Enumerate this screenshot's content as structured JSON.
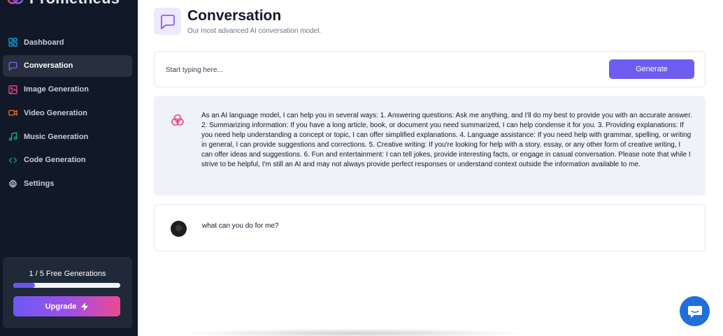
{
  "brand": {
    "name": "Prometheus"
  },
  "sidebar": {
    "items": [
      {
        "label": "Dashboard",
        "icon": "dashboard-icon",
        "color": "#0ea5e9"
      },
      {
        "label": "Conversation",
        "icon": "message-square-icon",
        "color": "#8b5cf6",
        "active": true
      },
      {
        "label": "Image Generation",
        "icon": "image-icon",
        "color": "#ec4899"
      },
      {
        "label": "Video Generation",
        "icon": "video-icon",
        "color": "#f97316"
      },
      {
        "label": "Music Generation",
        "icon": "music-icon",
        "color": "#10b981"
      },
      {
        "label": "Code Generation",
        "icon": "code-icon",
        "color": "#16a34a"
      },
      {
        "label": "Settings",
        "icon": "settings-icon",
        "color": "#d1d5db"
      }
    ],
    "usage": {
      "text": "1 / 5 Free Generations",
      "fraction": 0.2,
      "upgrade_label": "Upgrade"
    }
  },
  "header": {
    "title": "Conversation",
    "subtitle": "Our most advanced AI conversation model.",
    "accent": "#8b5cf6"
  },
  "prompt": {
    "placeholder": "Start typing here...",
    "value": "",
    "generate_label": "Generate"
  },
  "messages": [
    {
      "role": "assistant",
      "text": "As an AI language model, I can help you in several ways: 1. Answering questions: Ask me anything, and I'll do my best to provide you with an accurate answer. 2. Summarizing information: If you have a long article, book, or document you need summarized, I can help condense it for you. 3. Providing explanations: If you need help understanding a concept or topic, I can offer simplified explanations. 4. Language assistance: If you need help with grammar, spelling, or writing in general, I can provide suggestions and corrections. 5. Creative writing: If you're looking for help with a story, essay, or any other form of creative writing, I can offer ideas and suggestions. 6. Fun and entertainment: I can tell jokes, provide interesting facts, or engage in casual conversation. Please note that while I strive to be helpful, I'm still an AI and may not always provide perfect responses or understand context outside the information available to me."
    },
    {
      "role": "user",
      "text": "what can you do for me?"
    }
  ],
  "support": {
    "icon": "chat-bubble-icon",
    "color": "#1e6fd9"
  }
}
